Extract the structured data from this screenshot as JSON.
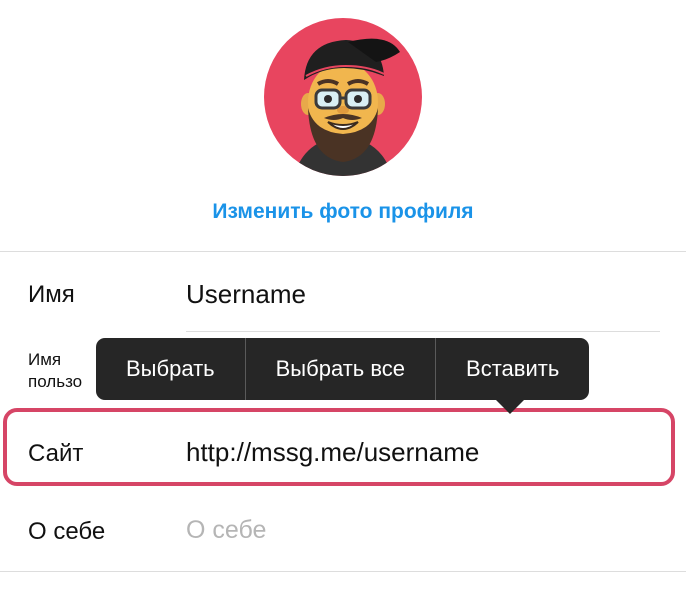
{
  "profile": {
    "change_photo_label": "Изменить фото профиля"
  },
  "fields": {
    "name": {
      "label": "Имя",
      "value": "Username"
    },
    "username": {
      "label_line1": "Имя",
      "label_line2": "пользо"
    },
    "website": {
      "label": "Сайт",
      "value": "http://mssg.me/username"
    },
    "bio": {
      "label": "О себе",
      "placeholder": "О себе"
    }
  },
  "context_menu": {
    "select": "Выбрать",
    "select_all": "Выбрать все",
    "paste": "Вставить"
  },
  "colors": {
    "accent": "#1a93e8",
    "avatar_bg": "#e8455f",
    "highlight": "#d64566",
    "menu_bg": "#262626"
  }
}
